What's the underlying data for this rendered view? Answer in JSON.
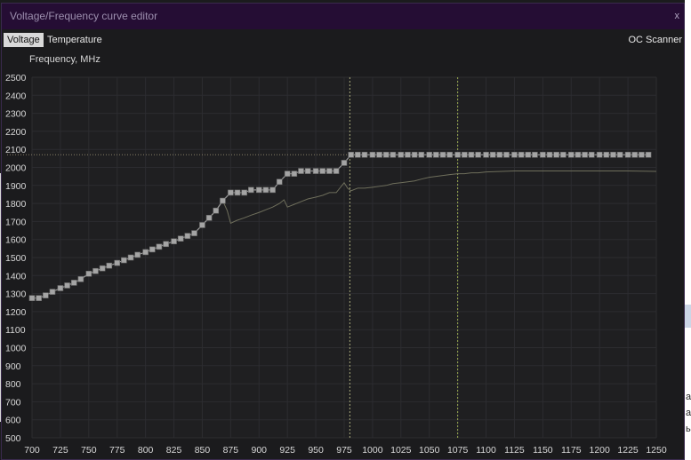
{
  "window": {
    "title": "Voltage/Frequency curve editor",
    "close_label": "x"
  },
  "tabs": [
    {
      "label": "Voltage",
      "active": true
    },
    {
      "label": "Temperature",
      "active": false
    }
  ],
  "oc_scanner_label": "OC Scanner",
  "background_fragments": [
    "а",
    "а",
    "ь"
  ],
  "colors": {
    "title_bar": "#250d34",
    "plot_bg": "#1f1f21",
    "grid": "#2c2c30",
    "curve_points": "#a4a4a4",
    "curve_line": "#9a9a9a",
    "actual_line": "#6f6f5c",
    "voltage_marker": "#a6a87a",
    "limit_marker": "#9bab50",
    "freq_cap_line": "#8a8068"
  },
  "chart_data": {
    "type": "line",
    "ylabel": "Frequency, MHz",
    "xlabel": "",
    "xlim": [
      700,
      1250
    ],
    "ylim": [
      500,
      2500
    ],
    "x_ticks": [
      700,
      725,
      750,
      775,
      800,
      825,
      850,
      875,
      900,
      925,
      950,
      975,
      1000,
      1025,
      1050,
      1075,
      1100,
      1125,
      1150,
      1175,
      1200,
      1225,
      1250
    ],
    "y_ticks": [
      500,
      600,
      700,
      800,
      900,
      1000,
      1100,
      1200,
      1300,
      1400,
      1500,
      1600,
      1700,
      1800,
      1900,
      2000,
      2100,
      2200,
      2300,
      2400,
      2500
    ],
    "grid": true,
    "markers": {
      "current_voltage": 980,
      "voltage_limit": 1075,
      "frequency_cap": 2070
    },
    "series": [
      {
        "x": [
          700,
          706,
          712,
          718,
          725,
          731,
          737,
          743,
          750,
          756,
          762,
          768,
          775,
          781,
          787,
          793,
          800,
          806,
          812,
          818,
          825,
          831,
          837,
          843,
          850,
          856,
          862,
          868,
          875,
          881,
          887,
          893,
          900,
          906,
          912,
          918,
          925,
          931,
          937,
          943,
          950,
          956,
          962,
          968,
          975,
          981,
          987,
          993,
          1000,
          1006,
          1012,
          1018,
          1025,
          1031,
          1037,
          1043,
          1050,
          1056,
          1062,
          1068,
          1075,
          1081,
          1087,
          1093,
          1100,
          1106,
          1112,
          1118,
          1125,
          1131,
          1137,
          1143,
          1150,
          1156,
          1162,
          1168,
          1175,
          1181,
          1187,
          1193,
          1200,
          1206,
          1212,
          1218,
          1225,
          1231,
          1237,
          1243
        ],
        "values": [
          1275,
          1275,
          1290,
          1310,
          1330,
          1345,
          1360,
          1380,
          1410,
          1425,
          1440,
          1455,
          1470,
          1485,
          1500,
          1515,
          1530,
          1545,
          1560,
          1575,
          1590,
          1605,
          1620,
          1635,
          1680,
          1720,
          1760,
          1815,
          1860,
          1860,
          1860,
          1875,
          1875,
          1875,
          1875,
          1920,
          1965,
          1965,
          1980,
          1980,
          1980,
          1980,
          1980,
          1980,
          2025,
          2070,
          2070,
          2070,
          2070,
          2070,
          2070,
          2070,
          2070,
          2070,
          2070,
          2070,
          2070,
          2070,
          2070,
          2070,
          2070,
          2070,
          2070,
          2070,
          2070,
          2070,
          2070,
          2070,
          2070,
          2070,
          2070,
          2070,
          2070,
          2070,
          2070,
          2070,
          2070,
          2070,
          2070,
          2070,
          2070,
          2070,
          2070,
          2070,
          2070,
          2070,
          2070,
          2070
        ]
      },
      {
        "x": [
          850,
          856,
          862,
          868,
          872,
          875,
          880,
          887,
          893,
          900,
          906,
          912,
          918,
          922,
          925,
          931,
          937,
          943,
          950,
          956,
          962,
          968,
          975,
          978,
          981,
          987,
          993,
          1000,
          1006,
          1012,
          1018,
          1025,
          1031,
          1037,
          1043,
          1050,
          1056,
          1062,
          1068,
          1075,
          1081,
          1087,
          1093,
          1100,
          1125,
          1150,
          1175,
          1200,
          1225,
          1250
        ],
        "values": [
          1680,
          1720,
          1760,
          1815,
          1760,
          1690,
          1705,
          1720,
          1735,
          1750,
          1765,
          1780,
          1800,
          1820,
          1780,
          1795,
          1810,
          1825,
          1835,
          1845,
          1860,
          1860,
          1915,
          1885,
          1870,
          1885,
          1885,
          1890,
          1895,
          1900,
          1910,
          1915,
          1920,
          1925,
          1935,
          1945,
          1950,
          1955,
          1960,
          1965,
          1965,
          1970,
          1970,
          1975,
          1980,
          1980,
          1980,
          1980,
          1980,
          1978
        ]
      }
    ]
  }
}
